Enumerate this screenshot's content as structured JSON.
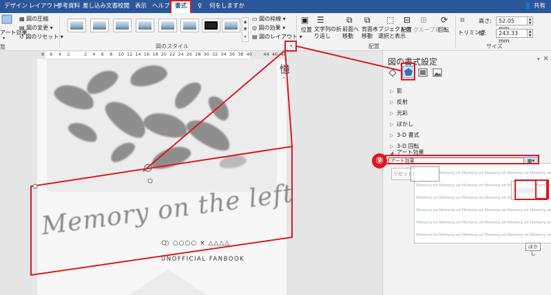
{
  "tabs": {
    "items": [
      "デザイン",
      "レイアウト",
      "参考資料",
      "差し込み文書",
      "校閲",
      "表示",
      "ヘルプ",
      "書式"
    ],
    "tell_me": "何をしますか",
    "share": "共有"
  },
  "ribbon": {
    "left_items": [
      "アート効果",
      "図の圧縮",
      "図の変更",
      "図のリセット"
    ],
    "left_fragment": "整",
    "style_group_label": "図のスタイル",
    "picture_format_items": [
      "図の枠線",
      "図の効果",
      "図のレイアウト"
    ],
    "arrange_items": [
      "位置",
      "文字列の折り返し",
      "前面へ移動",
      "背面へ移動",
      "オブジェクトの選択と表示",
      "配置",
      "グループ化",
      "回転"
    ],
    "arrange_label": "配置",
    "crop_label": "トリミング",
    "height_label": "高さ:",
    "height_value": "52.05 mm",
    "width_label": "幅:",
    "width_value": "243.33 mm",
    "size_label": "サイズ"
  },
  "ruler": {
    "numbers": [
      "8",
      "6",
      "4",
      "2",
      "",
      "2",
      "4",
      "6",
      "8",
      "10",
      "12",
      "14",
      "16",
      "18",
      "20",
      "22",
      "24",
      "26",
      "28",
      "30",
      "32",
      "34",
      "36",
      "38",
      "40",
      "",
      "44",
      "46",
      "48"
    ]
  },
  "document": {
    "kanji": "憶",
    "script_text": "Memory on the left",
    "symbols": "○ ○○○○ × △△△△",
    "fanbook": "UNOFFICIAL FANBOOK"
  },
  "pane": {
    "title": "図の書式設定",
    "close": "×",
    "sections": [
      "影",
      "反射",
      "光彩",
      "ぼかし",
      "3-D 書式",
      "3-D 回転",
      "アート効果"
    ],
    "art_effect_dropdown": "アート効果",
    "reset_label": "リセット(R)",
    "tooltip": "ぼかし",
    "gallery_sample": "Memory on the left"
  },
  "annotation": {
    "step": "⑨"
  },
  "colors": {
    "tab_bar": "#2b579a",
    "highlight_red": "#e0161d",
    "ribbon_bg": "#f3f3f3"
  }
}
